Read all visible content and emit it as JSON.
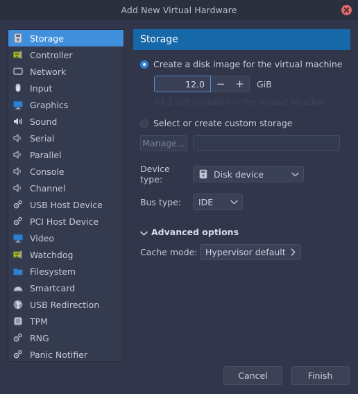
{
  "window": {
    "title": "Add New Virtual Hardware",
    "close_icon": "close-icon"
  },
  "sidebar": {
    "items": [
      {
        "label": "Storage",
        "icon": "disk-drive-icon",
        "selected": true
      },
      {
        "label": "Controller",
        "icon": "controller-card-icon",
        "selected": false
      },
      {
        "label": "Network",
        "icon": "monitor-outline-icon",
        "selected": false
      },
      {
        "label": "Input",
        "icon": "mouse-icon",
        "selected": false
      },
      {
        "label": "Graphics",
        "icon": "monitor-blue-icon",
        "selected": false
      },
      {
        "label": "Sound",
        "icon": "speaker-icon",
        "selected": false
      },
      {
        "label": "Serial",
        "icon": "speaker-outline-icon",
        "selected": false
      },
      {
        "label": "Parallel",
        "icon": "speaker-outline-icon",
        "selected": false
      },
      {
        "label": "Console",
        "icon": "speaker-outline-icon",
        "selected": false
      },
      {
        "label": "Channel",
        "icon": "speaker-outline-icon",
        "selected": false
      },
      {
        "label": "USB Host Device",
        "icon": "gears-icon",
        "selected": false
      },
      {
        "label": "PCI Host Device",
        "icon": "gears-icon",
        "selected": false
      },
      {
        "label": "Video",
        "icon": "monitor-blue-icon",
        "selected": false
      },
      {
        "label": "Watchdog",
        "icon": "controller-card-icon",
        "selected": false
      },
      {
        "label": "Filesystem",
        "icon": "folder-icon",
        "selected": false
      },
      {
        "label": "Smartcard",
        "icon": "smartcard-icon",
        "selected": false
      },
      {
        "label": "USB Redirection",
        "icon": "usb-icon",
        "selected": false
      },
      {
        "label": "TPM",
        "icon": "chip-icon",
        "selected": false
      },
      {
        "label": "RNG",
        "icon": "gears-icon",
        "selected": false
      },
      {
        "label": "Panic Notifier",
        "icon": "gears-icon",
        "selected": false
      }
    ]
  },
  "panel": {
    "title": "Storage",
    "create_disk": {
      "label": "Create a disk image for the virtual machine",
      "selected": true,
      "size_value": "12.0",
      "decrement_label": "−",
      "increment_label": "+",
      "unit": "GiB",
      "available_note": "43.1 GiB available in the default location"
    },
    "custom_storage": {
      "label": "Select or create custom storage",
      "selected": false,
      "manage_label": "Manage...",
      "path_value": "",
      "path_placeholder": ""
    },
    "device_type": {
      "label": "Device type:",
      "value": "Disk device",
      "icon": "disk-drive-icon",
      "chevron": "chevron-down-icon"
    },
    "bus_type": {
      "label": "Bus type:",
      "value": "IDE",
      "chevron": "chevron-down-icon"
    },
    "advanced": {
      "label": "Advanced options",
      "expanded": true,
      "chevron": "chevron-down-icon",
      "cache_mode": {
        "label": "Cache mode:",
        "value": "Hypervisor default",
        "chevron": "chevron-right-icon"
      }
    }
  },
  "footer": {
    "cancel_label": "Cancel",
    "finish_label": "Finish"
  },
  "colors": {
    "window_bg": "#31364a",
    "titlebar_bg": "#2b303f",
    "accent_header": "#1668a8",
    "selection": "#3f8fdd",
    "close_red": "#e06b6b"
  }
}
